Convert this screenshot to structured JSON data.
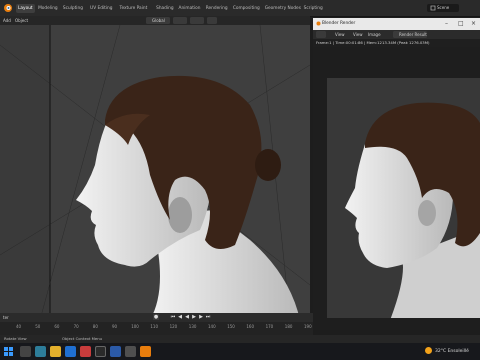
{
  "app": {
    "workspace_tabs": [
      "Layout",
      "Modeling",
      "Sculpting",
      "UV Editing",
      "Texture Paint",
      "Shading",
      "Animation",
      "Rendering",
      "Compositing",
      "Geometry Nodes",
      "Scripting"
    ],
    "active_tab": "Layout",
    "scene_name": "Scene"
  },
  "viewport_header": {
    "menus": [
      "Add",
      "Object"
    ],
    "orientation": "Global"
  },
  "render_window": {
    "title": "Blender Render",
    "toolbar": {
      "view_menu": "View",
      "image_menu": "Image",
      "view2": "View",
      "render_result": "Render Result"
    },
    "status": "Frame:1 | Time:00:01:86 | Mem:1213.34M (Peak 1276.03M)"
  },
  "timeline": {
    "ticks": [
      "40",
      "50",
      "60",
      "70",
      "80",
      "90",
      "100",
      "110",
      "120",
      "130",
      "140",
      "150",
      "160",
      "170",
      "180",
      "190"
    ],
    "left_label": "ter"
  },
  "status_bar": {
    "left": "Rotate View",
    "middle": "Object Context Menu"
  },
  "taskbar": {
    "temperature": "32°C",
    "weather": "Ensoleillé"
  },
  "colors": {
    "accent_blue": "#4772b3",
    "hair": "#3a2418",
    "skin": "#d9d9d9"
  }
}
